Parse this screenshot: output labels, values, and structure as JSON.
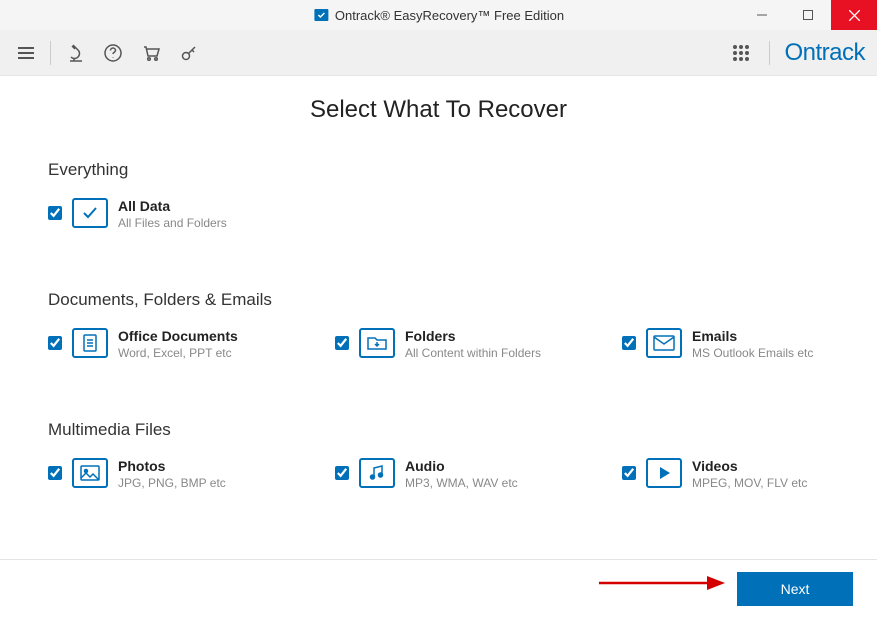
{
  "window": {
    "title": "Ontrack® EasyRecovery™ Free Edition"
  },
  "brand": "Ontrack",
  "page_title": "Select What To Recover",
  "sections": {
    "everything": {
      "title": "Everything",
      "all_data": {
        "title": "All Data",
        "sub": "All Files and Folders"
      }
    },
    "docs": {
      "title": "Documents, Folders & Emails",
      "office": {
        "title": "Office Documents",
        "sub": "Word, Excel, PPT etc"
      },
      "folders": {
        "title": "Folders",
        "sub": "All Content within Folders"
      },
      "emails": {
        "title": "Emails",
        "sub": "MS Outlook Emails etc"
      }
    },
    "media": {
      "title": "Multimedia Files",
      "photos": {
        "title": "Photos",
        "sub": "JPG, PNG, BMP etc"
      },
      "audio": {
        "title": "Audio",
        "sub": "MP3, WMA, WAV etc"
      },
      "videos": {
        "title": "Videos",
        "sub": "MPEG, MOV, FLV etc"
      }
    }
  },
  "footer": {
    "next": "Next"
  }
}
